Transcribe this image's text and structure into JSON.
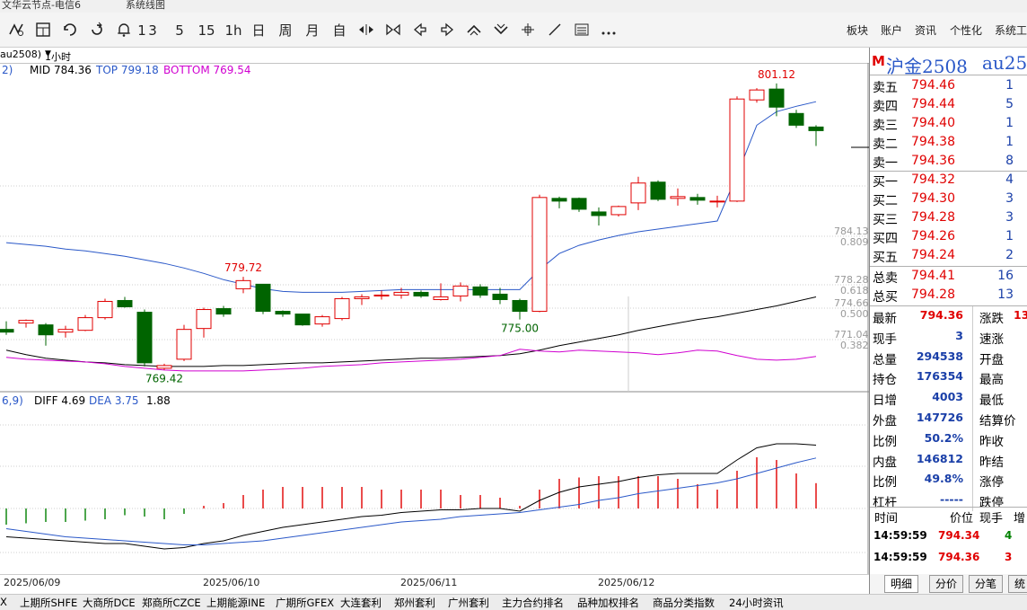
{
  "window": {
    "title_left": "文华云节点-电信6",
    "title_center": "系统线图"
  },
  "toolbar": {
    "icons": [
      "stock-icon",
      "grid-icon",
      "refresh-icon",
      "back-icon",
      "bell-icon"
    ],
    "periods": [
      "1",
      "3",
      "5",
      "15",
      "1h",
      "日",
      "周",
      "月",
      "自"
    ],
    "nav_icons": [
      "shrink-icon",
      "expand-icon",
      "left-arrow-icon",
      "right-arrow-icon",
      "zoom-in-icon",
      "zoom-out-icon",
      "crosshair-icon",
      "line-tool-icon",
      "list-icon",
      "more-icon"
    ],
    "right_menu": [
      "板块",
      "账户",
      "资讯",
      "个性化",
      "系统工"
    ]
  },
  "subbar": {
    "contract": "au2508)",
    "period": "1小时",
    "period_arrow": "▼",
    "boll_prefix": "2)",
    "mid_label": "MID 784.36",
    "top_label": "TOP 799.18",
    "bottom_label": "BOTTOM 769.54"
  },
  "macd_header": {
    "prefix": "6,9)",
    "diff": "DIFF 4.69",
    "dea": "DEA 3.75",
    "macd": "1.88"
  },
  "quote": {
    "title_mark": "M",
    "title": "沪金2508",
    "code": "au25(",
    "asks": [
      {
        "label": "卖五",
        "price": "794.46",
        "vol": "1"
      },
      {
        "label": "卖四",
        "price": "794.44",
        "vol": "5"
      },
      {
        "label": "卖三",
        "price": "794.40",
        "vol": "1"
      },
      {
        "label": "卖二",
        "price": "794.38",
        "vol": "1"
      },
      {
        "label": "卖一",
        "price": "794.36",
        "vol": "8"
      }
    ],
    "bids": [
      {
        "label": "买一",
        "price": "794.32",
        "vol": "4"
      },
      {
        "label": "买二",
        "price": "794.30",
        "vol": "3"
      },
      {
        "label": "买三",
        "price": "794.28",
        "vol": "3"
      },
      {
        "label": "买四",
        "price": "794.26",
        "vol": "1"
      },
      {
        "label": "买五",
        "price": "794.24",
        "vol": "2"
      }
    ],
    "totals": [
      {
        "label": "总卖",
        "price": "794.41",
        "vol": "16"
      },
      {
        "label": "总买",
        "price": "794.28",
        "vol": "13"
      }
    ],
    "stats": [
      {
        "label": "最新",
        "value": "794.36",
        "label2": "涨跌",
        "value2": "13",
        "color": "#e00000"
      },
      {
        "label": "现手",
        "value": "3",
        "label2": "速涨",
        "value2": "",
        "color": "#1a3fa8"
      },
      {
        "label": "总量",
        "value": "294538",
        "label2": "开盘",
        "value2": "",
        "color": "#1a3fa8"
      },
      {
        "label": "持仓",
        "value": "176354",
        "label2": "最高",
        "value2": "",
        "color": "#1a3fa8"
      },
      {
        "label": "日增",
        "value": "4003",
        "label2": "最低",
        "value2": "",
        "color": "#1a3fa8"
      },
      {
        "label": "外盘",
        "value": "147726",
        "label2": "结算价",
        "value2": "",
        "color": "#1a3fa8"
      },
      {
        "label": "比例",
        "value": "50.2%",
        "label2": "昨收",
        "value2": "",
        "color": "#1a3fa8"
      },
      {
        "label": "内盘",
        "value": "146812",
        "label2": "昨结",
        "value2": "",
        "color": "#1a3fa8"
      },
      {
        "label": "比例",
        "value": "49.8%",
        "label2": "涨停",
        "value2": "",
        "color": "#1a3fa8"
      },
      {
        "label": "杠杆",
        "value": "-----",
        "label2": "跌停",
        "value2": "",
        "color": "#1a3fa8"
      }
    ],
    "ticks_header": {
      "time": "时间",
      "price": "价位",
      "vol": "现手",
      "oi": "增"
    },
    "ticks": [
      {
        "time": "14:59:59",
        "price": "794.34",
        "vol": "4",
        "vol_color": "#008000"
      },
      {
        "time": "14:59:59",
        "price": "794.36",
        "vol": "3",
        "vol_color": "#e00000"
      }
    ]
  },
  "bottom_tabs": [
    "明细",
    "分价",
    "分笔",
    "统"
  ],
  "status_items": [
    "X",
    "上期所SHFE",
    "大商所DCE",
    "郑商所CZCE",
    "上期能源INE",
    "广期所GFEX",
    "大连套利",
    "郑州套利",
    "广州套利",
    "主力合约排名",
    "品种加权排名",
    "商品分类指数",
    "24小时资讯"
  ],
  "colors": {
    "up": "#e00000",
    "down": "#006400",
    "mid": "#000000",
    "top": "#2a58c8",
    "bottom": "#d000d0",
    "dea": "#2a58c8",
    "diff": "#000000",
    "grid": "#c8c8c8"
  },
  "chart_data": {
    "type": "candlestick",
    "dates": [
      "2025/06/09",
      "2025/06/10",
      "2025/06/11",
      "2025/06/12"
    ],
    "annotations": [
      {
        "label": "779.72",
        "kind": "high"
      },
      {
        "label": "769.42",
        "kind": "low"
      },
      {
        "label": "775.00",
        "kind": "low"
      },
      {
        "label": "801.12",
        "kind": "high"
      }
    ],
    "fib_levels": [
      {
        "price": "784.13",
        "ratio": "0.809"
      },
      {
        "price": "778.28",
        "ratio": "0.618"
      },
      {
        "price": "774.66",
        "ratio": "0.500"
      },
      {
        "price": "771.04",
        "ratio": "0.382"
      }
    ],
    "price_range": [
      768,
      803
    ],
    "candles": [
      {
        "o": 773.9,
        "h": 774.8,
        "l": 773.3,
        "c": 773.6
      },
      {
        "o": 774.6,
        "h": 775.0,
        "l": 774.1,
        "c": 774.9
      },
      {
        "o": 774.4,
        "h": 774.6,
        "l": 772.1,
        "c": 773.3
      },
      {
        "o": 773.6,
        "h": 774.3,
        "l": 773.0,
        "c": 773.9
      },
      {
        "o": 773.8,
        "h": 775.5,
        "l": 773.7,
        "c": 775.2
      },
      {
        "o": 775.2,
        "h": 777.3,
        "l": 775.0,
        "c": 777.0
      },
      {
        "o": 777.1,
        "h": 777.5,
        "l": 776.3,
        "c": 776.4
      },
      {
        "o": 775.8,
        "h": 776.1,
        "l": 769.8,
        "c": 770.2
      },
      {
        "o": 769.6,
        "h": 770.1,
        "l": 769.42,
        "c": 769.9
      },
      {
        "o": 770.6,
        "h": 774.4,
        "l": 770.4,
        "c": 773.9
      },
      {
        "o": 774.0,
        "h": 776.3,
        "l": 773.0,
        "c": 776.1
      },
      {
        "o": 776.2,
        "h": 776.5,
        "l": 775.3,
        "c": 775.6
      },
      {
        "o": 778.4,
        "h": 779.72,
        "l": 777.9,
        "c": 779.3
      },
      {
        "o": 778.9,
        "h": 778.9,
        "l": 775.6,
        "c": 775.9
      },
      {
        "o": 775.9,
        "h": 776.0,
        "l": 775.3,
        "c": 775.6
      },
      {
        "o": 775.6,
        "h": 775.6,
        "l": 774.3,
        "c": 774.4
      },
      {
        "o": 774.5,
        "h": 775.5,
        "l": 774.2,
        "c": 775.3
      },
      {
        "o": 775.1,
        "h": 777.5,
        "l": 774.9,
        "c": 777.3
      },
      {
        "o": 777.3,
        "h": 777.8,
        "l": 776.6,
        "c": 777.5
      },
      {
        "o": 777.6,
        "h": 778.2,
        "l": 777.2,
        "c": 777.7
      },
      {
        "o": 777.7,
        "h": 778.5,
        "l": 777.3,
        "c": 778.0
      },
      {
        "o": 778.0,
        "h": 778.2,
        "l": 777.4,
        "c": 777.6
      },
      {
        "o": 777.2,
        "h": 779.0,
        "l": 777.1,
        "c": 777.5
      },
      {
        "o": 777.6,
        "h": 779.1,
        "l": 777.0,
        "c": 778.7
      },
      {
        "o": 778.6,
        "h": 778.9,
        "l": 777.4,
        "c": 777.7
      },
      {
        "o": 777.8,
        "h": 778.5,
        "l": 776.7,
        "c": 777.2
      },
      {
        "o": 777.1,
        "h": 777.3,
        "l": 775.0,
        "c": 775.9
      },
      {
        "o": 775.9,
        "h": 788.8,
        "l": 775.8,
        "c": 788.5
      },
      {
        "o": 788.4,
        "h": 788.6,
        "l": 787.3,
        "c": 788.1
      },
      {
        "o": 788.4,
        "h": 788.5,
        "l": 786.9,
        "c": 787.2
      },
      {
        "o": 786.9,
        "h": 787.4,
        "l": 785.4,
        "c": 786.5
      },
      {
        "o": 786.6,
        "h": 787.6,
        "l": 786.4,
        "c": 787.5
      },
      {
        "o": 787.9,
        "h": 790.8,
        "l": 787.1,
        "c": 790.1
      },
      {
        "o": 790.2,
        "h": 790.4,
        "l": 788.1,
        "c": 788.3
      },
      {
        "o": 788.4,
        "h": 789.5,
        "l": 787.6,
        "c": 788.6
      },
      {
        "o": 788.5,
        "h": 788.9,
        "l": 787.7,
        "c": 788.2
      },
      {
        "o": 788.1,
        "h": 788.7,
        "l": 787.4,
        "c": 788.1
      },
      {
        "o": 788.1,
        "h": 799.7,
        "l": 788.0,
        "c": 799.4
      },
      {
        "o": 799.3,
        "h": 800.6,
        "l": 799.0,
        "c": 800.4
      },
      {
        "o": 800.5,
        "h": 801.12,
        "l": 797.5,
        "c": 798.5
      },
      {
        "o": 797.8,
        "h": 798.2,
        "l": 796.2,
        "c": 796.5
      },
      {
        "o": 796.3,
        "h": 796.5,
        "l": 794.2,
        "c": 795.9
      }
    ],
    "mid": [
      771.6,
      771.1,
      770.7,
      770.5,
      770.3,
      770.2,
      770.0,
      769.9,
      769.8,
      769.8,
      769.8,
      769.9,
      769.9,
      770.0,
      770.1,
      770.2,
      770.2,
      770.3,
      770.4,
      770.5,
      770.6,
      770.7,
      770.7,
      770.8,
      770.9,
      771.0,
      771.2,
      771.6,
      772.1,
      772.5,
      772.9,
      773.3,
      773.8,
      774.2,
      774.6,
      775.0,
      775.3,
      775.7,
      776.1,
      776.5,
      777.0,
      777.5
    ],
    "top_band": [
      783.5,
      783.3,
      783.1,
      782.8,
      782.6,
      782.3,
      782.0,
      781.6,
      781.2,
      780.7,
      780.1,
      779.4,
      778.9,
      778.4,
      778.1,
      778.0,
      778.0,
      778.0,
      778.1,
      778.2,
      778.3,
      778.3,
      778.3,
      778.3,
      778.3,
      778.3,
      778.3,
      780.5,
      782.3,
      783.2,
      783.8,
      784.3,
      784.7,
      785.0,
      785.3,
      785.6,
      785.9,
      791.0,
      796.5,
      798.0,
      798.6,
      799.1
    ],
    "bottom_band": [
      770.8,
      770.6,
      770.5,
      770.4,
      770.3,
      770.1,
      769.8,
      769.6,
      769.4,
      769.3,
      769.3,
      769.3,
      769.3,
      769.4,
      769.5,
      769.6,
      769.8,
      769.9,
      770.0,
      770.2,
      770.3,
      770.4,
      770.5,
      770.6,
      770.8,
      771.0,
      771.7,
      771.5,
      771.4,
      771.6,
      771.5,
      771.4,
      771.3,
      771.1,
      771.3,
      771.6,
      771.5,
      771.0,
      770.6,
      770.5,
      770.6,
      770.9
    ],
    "macd": {
      "diff": [
        -2.1,
        -2.2,
        -2.3,
        -2.4,
        -2.5,
        -2.6,
        -2.6,
        -2.8,
        -3.0,
        -2.9,
        -2.6,
        -2.4,
        -2.0,
        -1.7,
        -1.4,
        -1.2,
        -1.0,
        -0.8,
        -0.6,
        -0.5,
        -0.3,
        -0.2,
        -0.1,
        -0.1,
        0.0,
        0.0,
        -0.2,
        0.6,
        1.2,
        1.6,
        1.8,
        2.0,
        2.3,
        2.5,
        2.6,
        2.6,
        2.6,
        3.6,
        4.5,
        4.8,
        4.8,
        4.7
      ],
      "dea": [
        -1.5,
        -1.7,
        -1.9,
        -2.1,
        -2.2,
        -2.3,
        -2.4,
        -2.5,
        -2.6,
        -2.7,
        -2.7,
        -2.6,
        -2.5,
        -2.4,
        -2.2,
        -2.0,
        -1.8,
        -1.6,
        -1.4,
        -1.2,
        -1.0,
        -0.9,
        -0.8,
        -0.6,
        -0.5,
        -0.4,
        -0.3,
        -0.1,
        0.1,
        0.3,
        0.6,
        0.8,
        1.1,
        1.3,
        1.5,
        1.7,
        1.9,
        2.2,
        2.6,
        3.0,
        3.4,
        3.75
      ],
      "hist": [
        -1.2,
        -1.1,
        -1.0,
        -1.0,
        -0.9,
        -0.8,
        -0.5,
        -0.6,
        -0.8,
        -0.4,
        0.2,
        0.4,
        1.0,
        1.4,
        1.6,
        1.6,
        1.6,
        1.6,
        1.6,
        1.4,
        1.4,
        1.4,
        1.4,
        1.0,
        1.0,
        0.8,
        0.2,
        1.4,
        2.2,
        2.3,
        2.4,
        2.4,
        2.4,
        2.4,
        2.2,
        1.8,
        1.4,
        2.8,
        3.8,
        3.6,
        2.6,
        1.88
      ]
    }
  }
}
